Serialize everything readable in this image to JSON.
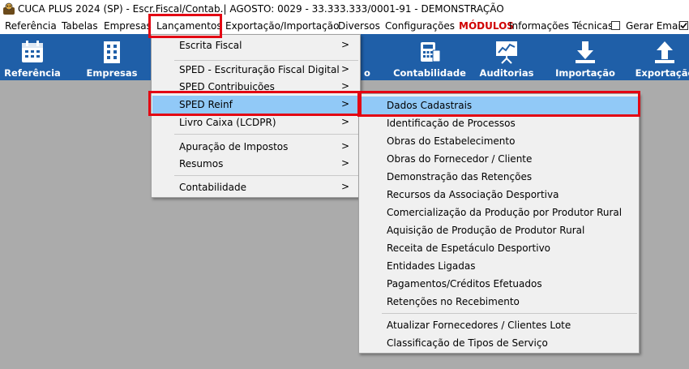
{
  "window": {
    "title": "CUCA PLUS 2024 (SP) - Escr.Fiscal/Contab.| AGOSTO: 0029 - 33.333.333/0001-91 - DEMONSTRAÇÃO"
  },
  "menubar": {
    "items": [
      "Referência",
      "Tabelas",
      "Empresas",
      "Lançamentos",
      "Exportação/Importação",
      "Diversos",
      "Configurações",
      "MÓDULOS",
      "Informações Técnicas"
    ],
    "gerar_email": "Gerar Email",
    "gerar_email_checked": false,
    "extra_checkbox_checked": true
  },
  "toolbar": {
    "buttons": [
      {
        "label": "Referência",
        "icon": "calendar-icon"
      },
      {
        "label": "Empresas",
        "icon": "building-icon"
      },
      {
        "label": "o",
        "icon": ""
      },
      {
        "label": "Contabilidade",
        "icon": "calculator-icon"
      },
      {
        "label": "Auditorias",
        "icon": "presentation-chart-icon"
      },
      {
        "label": "Importação",
        "icon": "download-arrow-icon"
      },
      {
        "label": "Exportação",
        "icon": "upload-arrow-icon"
      }
    ]
  },
  "lancamentos_menu": {
    "items": [
      {
        "label": "Escrita Fiscal",
        "submenu": true
      },
      {
        "label": "SPED - Escrituração Fiscal Digital",
        "submenu": true
      },
      {
        "label": "SPED Contribuições",
        "submenu": true
      },
      {
        "label": "SPED Reinf",
        "submenu": true,
        "highlighted": true
      },
      {
        "label": "Livro Caixa (LCDPR)",
        "submenu": true
      },
      {
        "label": "Apuração de Impostos",
        "submenu": true
      },
      {
        "label": "Resumos",
        "submenu": true
      },
      {
        "label": "Contabilidade",
        "submenu": true
      }
    ]
  },
  "reinf_menu": {
    "items": [
      {
        "label": "Dados Cadastrais",
        "highlighted": true
      },
      {
        "label": "Identificação de Processos"
      },
      {
        "label": "Obras do Estabelecimento"
      },
      {
        "label": "Obras do Fornecedor / Cliente"
      },
      {
        "label": "Demonstração das Retenções"
      },
      {
        "label": "Recursos da Associação Desportiva"
      },
      {
        "label": "Comercialização da Produção por Produtor Rural"
      },
      {
        "label": "Aquisição de Produção de Produtor Rural"
      },
      {
        "label": "Receita de Espetáculo Desportivo"
      },
      {
        "label": "Entidades Ligadas"
      },
      {
        "label": "Pagamentos/Créditos Efetuados"
      },
      {
        "label": "Retenções no Recebimento"
      },
      {
        "label": "Atualizar Fornecedores / Clientes Lote"
      },
      {
        "label": "Classificação de Tipos de Serviço"
      }
    ]
  },
  "submenu_arrow": ">",
  "colors": {
    "toolbar": "#1f5fa8",
    "highlight": "#91c9f7",
    "annotation": "#e30613",
    "workspace": "#ababab"
  }
}
